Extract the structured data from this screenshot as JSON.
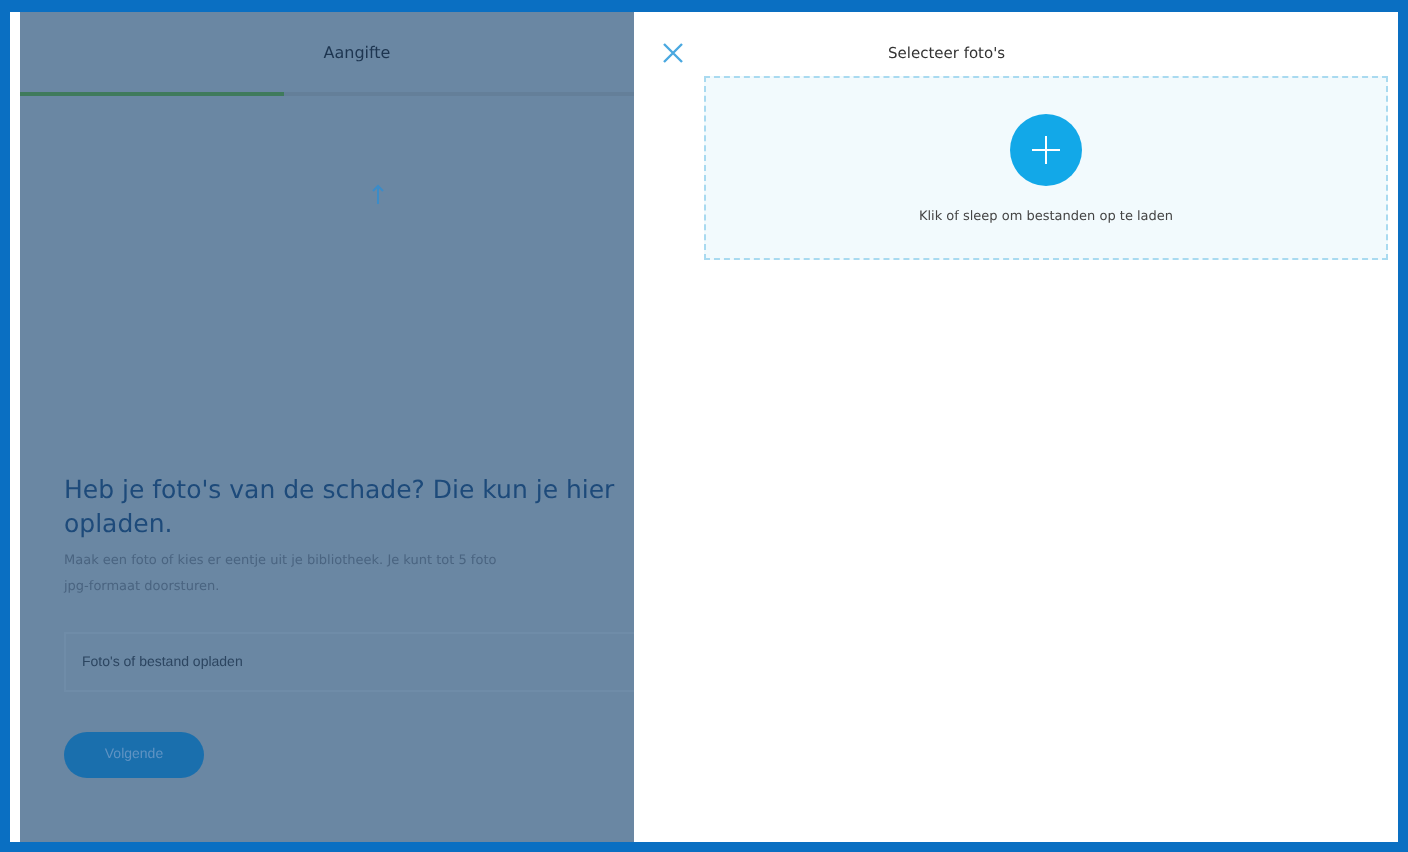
{
  "background": {
    "tab": {
      "label": "Aangifte"
    },
    "progress": {
      "level": 0.43
    },
    "heading": "Heb je foto's van de schade? Die kun je hier opladen.",
    "description": [
      "Maak een foto of kies er eentje uit je bibliotheek. Je kunt tot 5 foto",
      "jpg-formaat doorsturen."
    ],
    "upload_field": {
      "placeholder": "Foto's of bestand opladen"
    },
    "next_button": "Volgende"
  },
  "panel": {
    "title": "Selecteer foto's",
    "dropzone": {
      "hint": "Klik of sleep om bestanden op te laden"
    }
  }
}
